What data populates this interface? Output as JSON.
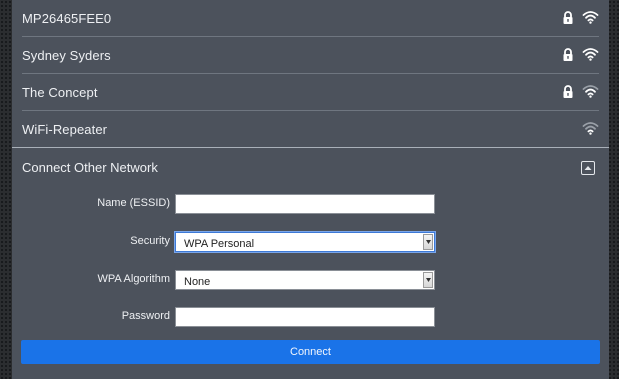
{
  "networks": [
    {
      "ssid": "MP26465FEE0",
      "secured": true,
      "signal": "strong"
    },
    {
      "ssid": "Sydney Syders",
      "secured": true,
      "signal": "strong"
    },
    {
      "ssid": "The Concept",
      "secured": true,
      "signal": "weak"
    },
    {
      "ssid": "WiFi-Repeater",
      "secured": false,
      "signal": "weak"
    }
  ],
  "connect_other": {
    "title": "Connect Other Network",
    "name_label": "Name (ESSID)",
    "name_value": "",
    "security_label": "Security",
    "security_value": "WPA Personal",
    "algorithm_label": "WPA Algorithm",
    "algorithm_value": "None",
    "password_label": "Password",
    "password_value": "",
    "connect_label": "Connect"
  },
  "icons": {
    "lock": "lock-icon",
    "wifi": "wifi-icon",
    "collapse": "collapse-up-icon",
    "dropdown_arrow": "chevron-down-icon"
  },
  "colors": {
    "panel": "#4c525c",
    "accent": "#1a73e8",
    "text": "#eef0f3",
    "icon_strong": "#ffffff",
    "icon_weak": "#9aa0a8"
  }
}
